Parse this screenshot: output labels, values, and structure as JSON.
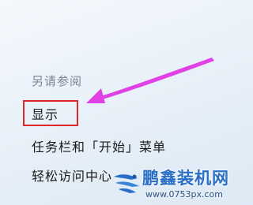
{
  "see_also": {
    "heading": "另请参阅",
    "links": [
      {
        "label": "显示"
      },
      {
        "label": "任务栏和「开始」菜单"
      },
      {
        "label": "轻松访问中心"
      }
    ]
  },
  "annotation": {
    "highlight_color": "#e0262b",
    "arrow_color": "#e040e6"
  },
  "watermark": {
    "title": "鹏鑫装机网",
    "url": "www.0753px.com",
    "color": "#2a6fc4"
  }
}
